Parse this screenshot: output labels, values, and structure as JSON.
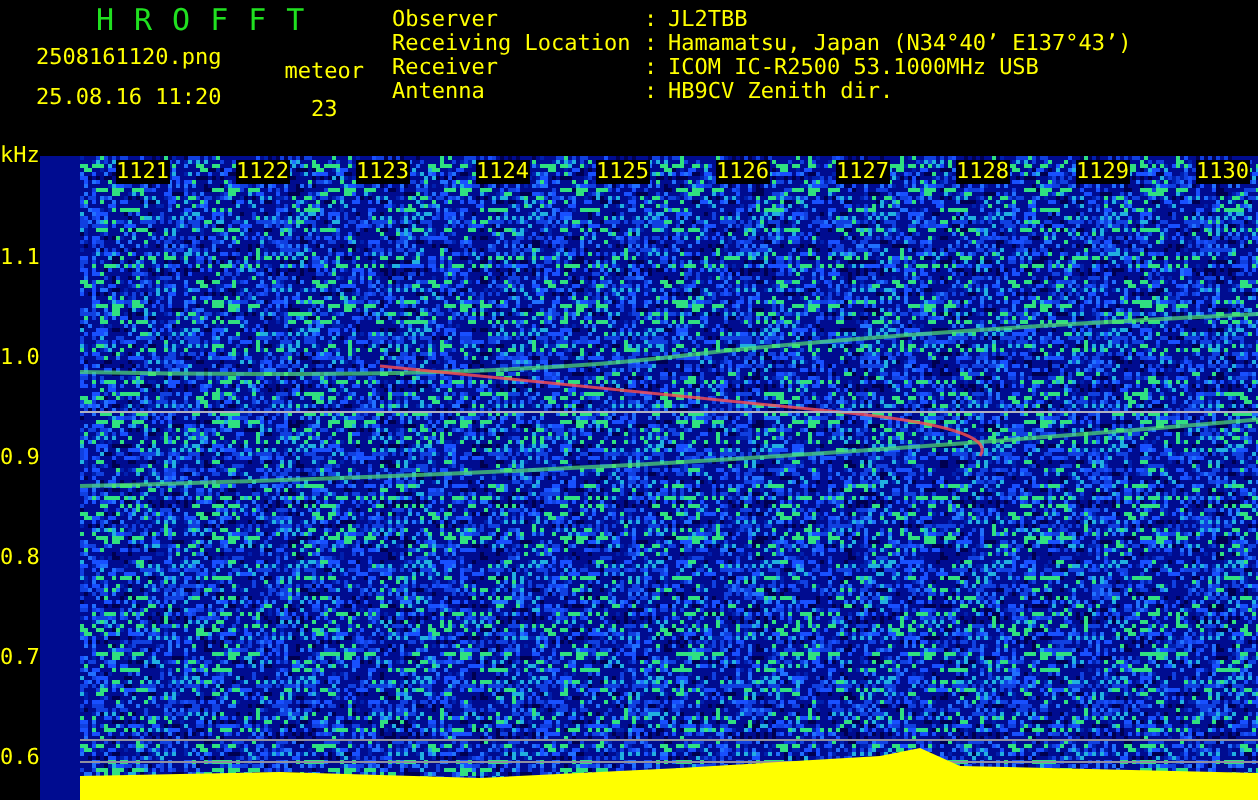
{
  "app_title": "HROFFT",
  "file_name": "2508161120.png",
  "timestamp": "25.08.16 11:20",
  "meteor": {
    "label": "meteor",
    "count": "23"
  },
  "station_info": [
    {
      "label": "Observer",
      "separator": ":",
      "value": "JL2TBB"
    },
    {
      "label": "Receiving Location",
      "separator": ":",
      "value": "Hamamatsu, Japan (N34°40’ E137°43’)"
    },
    {
      "label": "Receiver",
      "separator": ":",
      "value": "ICOM IC-R2500 53.1000MHz USB"
    },
    {
      "label": "Antenna",
      "separator": ":",
      "value": "HB9CV Zenith dir."
    }
  ],
  "spectrogram": {
    "unit": "kHz",
    "time_labels": [
      "1121",
      "1122",
      "1123",
      "1124",
      "1125",
      "1126",
      "1127",
      "1128",
      "1129",
      "1130"
    ],
    "frequency_labels": [
      "1.1",
      "1.0",
      "0.9",
      "0.8",
      "0.7",
      "0.6"
    ]
  }
}
